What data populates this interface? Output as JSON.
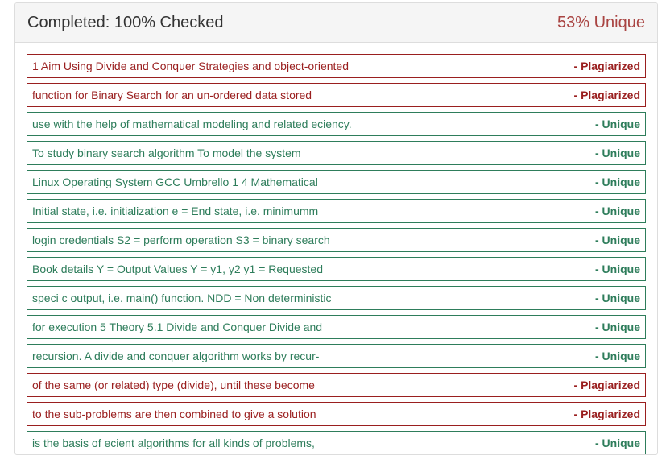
{
  "header": {
    "status": "Completed: 100% Checked",
    "unique_percent": "53% Unique"
  },
  "colors": {
    "plagiarized": "#9a1f1f",
    "unique": "#2e7d5b",
    "header_accent": "#a94442"
  },
  "results": [
    {
      "text": "1 Aim Using Divide and Conquer Strategies and object-oriented",
      "verdict": "- Plagiarized",
      "status": "plagiarized"
    },
    {
      "text": "function for Binary Search for an un-ordered data stored",
      "verdict": "- Plagiarized",
      "status": "plagiarized"
    },
    {
      "text": "use with the help of mathematical modeling and related eciency.",
      "verdict": "- Unique",
      "status": "unique"
    },
    {
      "text": "To study binary search algorithm To model the system",
      "verdict": "- Unique",
      "status": "unique"
    },
    {
      "text": "Linux Operating System GCC Umbrello 1 4 Mathematical",
      "verdict": "- Unique",
      "status": "unique"
    },
    {
      "text": "Initial state, i.e. initialization e = End state, i.e. minimumm",
      "verdict": "- Unique",
      "status": "unique"
    },
    {
      "text": "login credentials S2 = perform operation S3 = binary search",
      "verdict": "- Unique",
      "status": "unique"
    },
    {
      "text": "Book details Y = Output Values Y = y1, y2 y1 = Requested",
      "verdict": "- Unique",
      "status": "unique"
    },
    {
      "text": "speci c output, i.e. main() function. NDD = Non deterministic",
      "verdict": "- Unique",
      "status": "unique"
    },
    {
      "text": "for execution 5 Theory 5.1 Divide and Conquer Divide and",
      "verdict": "- Unique",
      "status": "unique"
    },
    {
      "text": "recursion. A divide and conquer algorithm works by recur-",
      "verdict": "- Unique",
      "status": "unique"
    },
    {
      "text": "of the same (or related) type (divide), until these become",
      "verdict": "- Plagiarized",
      "status": "plagiarized"
    },
    {
      "text": "to the sub-problems are then combined to give a solution",
      "verdict": "- Plagiarized",
      "status": "plagiarized"
    },
    {
      "text": "is the basis of ecient algorithms for all kinds of problems,",
      "verdict": "- Unique",
      "status": "unique"
    }
  ]
}
